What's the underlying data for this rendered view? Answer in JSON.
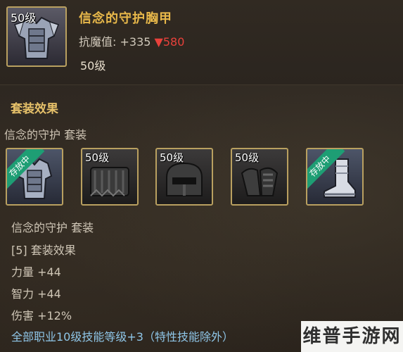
{
  "item": {
    "level_tag": "50级",
    "name": "信念的守护胸甲",
    "stat_label": "抗魔值: +335",
    "stat_down_arrow": "▼",
    "stat_down_value": "580",
    "level": "50级"
  },
  "set": {
    "heading": "套装效果",
    "name": "信念的守护  套装",
    "slots": [
      {
        "badge": "存放中",
        "level_tag": "",
        "icon": "chest-armor-icon"
      },
      {
        "badge": "",
        "level_tag": "50级",
        "icon": "leg-armor-icon"
      },
      {
        "badge": "",
        "level_tag": "50级",
        "icon": "helmet-icon"
      },
      {
        "badge": "",
        "level_tag": "50级",
        "icon": "shoulder-armor-icon"
      },
      {
        "badge": "存放中",
        "level_tag": "",
        "icon": "boots-icon"
      }
    ],
    "info_name": "信念的守护  套装",
    "effect_label": "[5] 套装效果",
    "stats": [
      "力量 +44",
      "智力 +44",
      "伤害 +12%"
    ],
    "bonus": "全部职业10级技能等级+3（特性技能除外）"
  },
  "watermark": "维普手游网",
  "colors": {
    "title": "#e8b84a",
    "down": "#e8413b",
    "bonus": "#8fc6e8",
    "frame": "#b9a060",
    "ribbon": "#1e9e74"
  }
}
